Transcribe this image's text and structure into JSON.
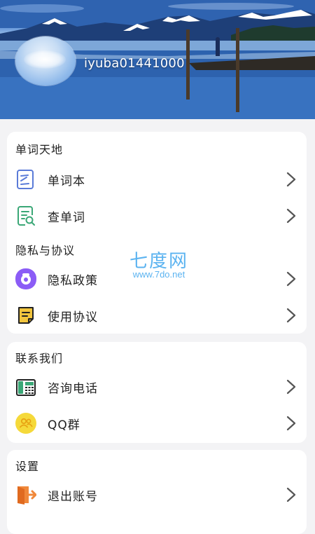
{
  "profile": {
    "username": "iyuba01441000"
  },
  "sections": [
    {
      "title": "单词天地",
      "items": [
        {
          "label": "单词本",
          "icon": "wordbook-icon"
        },
        {
          "label": "查单词",
          "icon": "word-search-icon"
        }
      ]
    },
    {
      "title": "隐私与协议",
      "items": [
        {
          "label": "隐私政策",
          "icon": "privacy-icon"
        },
        {
          "label": "使用协议",
          "icon": "agreement-icon"
        }
      ]
    },
    {
      "title": "联系我们",
      "items": [
        {
          "label": "咨询电话",
          "icon": "phone-icon"
        },
        {
          "label": "QQ群",
          "icon": "qq-group-icon"
        }
      ]
    },
    {
      "title": "设置",
      "items": [
        {
          "label": "退出账号",
          "icon": "logout-icon"
        }
      ]
    }
  ],
  "watermark": {
    "title": "七度网",
    "url": "www.7do.net"
  },
  "colors": {
    "accent_blue": "#5a7bd8",
    "icon_green": "#3aa776",
    "privacy_purple": "#8b5cf6",
    "note_yellow": "#f2c53d",
    "qq_yellow": "#f5d93a",
    "logout_orange": "#f0883a",
    "chevron": "#555555"
  }
}
